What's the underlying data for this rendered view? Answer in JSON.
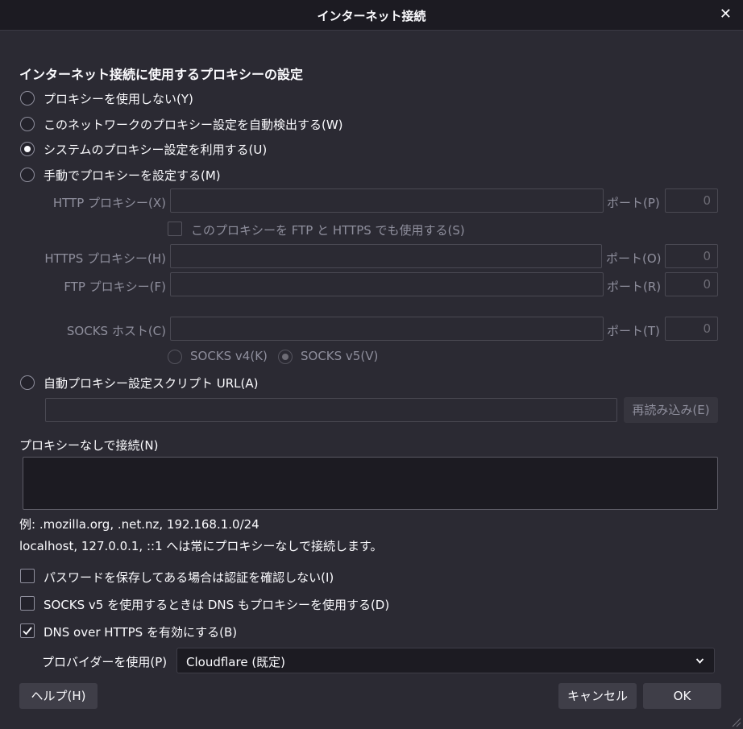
{
  "window": {
    "title": "インターネット接続"
  },
  "section_title": "インターネット接続に使用するプロキシーの設定",
  "proxy_options": [
    {
      "label": "プロキシーを使用しない(Y)",
      "selected": false
    },
    {
      "label": "このネットワークのプロキシー設定を自動検出する(W)",
      "selected": false
    },
    {
      "label": "システムのプロキシー設定を利用する(U)",
      "selected": true
    },
    {
      "label": "手動でプロキシーを設定する(M)",
      "selected": false
    }
  ],
  "manual": {
    "http_label": "HTTP プロキシー(X)",
    "https_label": "HTTPS プロキシー(H)",
    "ftp_label": "FTP プロキシー(F)",
    "socks_label": "SOCKS ホスト(C)",
    "port_p": "ポート(P)",
    "port_o": "ポート(O)",
    "port_r": "ポート(R)",
    "port_t": "ポート(T)",
    "http_port": "0",
    "https_port": "0",
    "ftp_port": "0",
    "socks_port": "0",
    "share_label": "このプロキシーを FTP と HTTPS でも使用する(S)",
    "socks_v4": "SOCKS v4(K)",
    "socks_v5": "SOCKS v5(V)"
  },
  "auto_url": {
    "label": "自動プロキシー設定スクリプト URL(A)",
    "reload": "再読み込み(E)"
  },
  "no_proxy": {
    "label": "プロキシーなしで接続(N)",
    "example": "例: .mozilla.org, .net.nz, 192.168.1.0/24",
    "note": "localhost, 127.0.0.1, ::1 へは常にプロキシーなしで接続します。"
  },
  "checkboxes": [
    {
      "label": "パスワードを保存してある場合は認証を確認しない(I)",
      "checked": false
    },
    {
      "label": "SOCKS v5 を使用するときは DNS もプロキシーを使用する(D)",
      "checked": false
    },
    {
      "label": "DNS over HTTPS を有効にする(B)",
      "checked": true
    }
  ],
  "provider": {
    "label": "プロバイダーを使用(P)",
    "value": "Cloudflare (既定)"
  },
  "buttons": {
    "help": "ヘルプ(H)",
    "cancel": "キャンセル",
    "ok": "OK"
  }
}
